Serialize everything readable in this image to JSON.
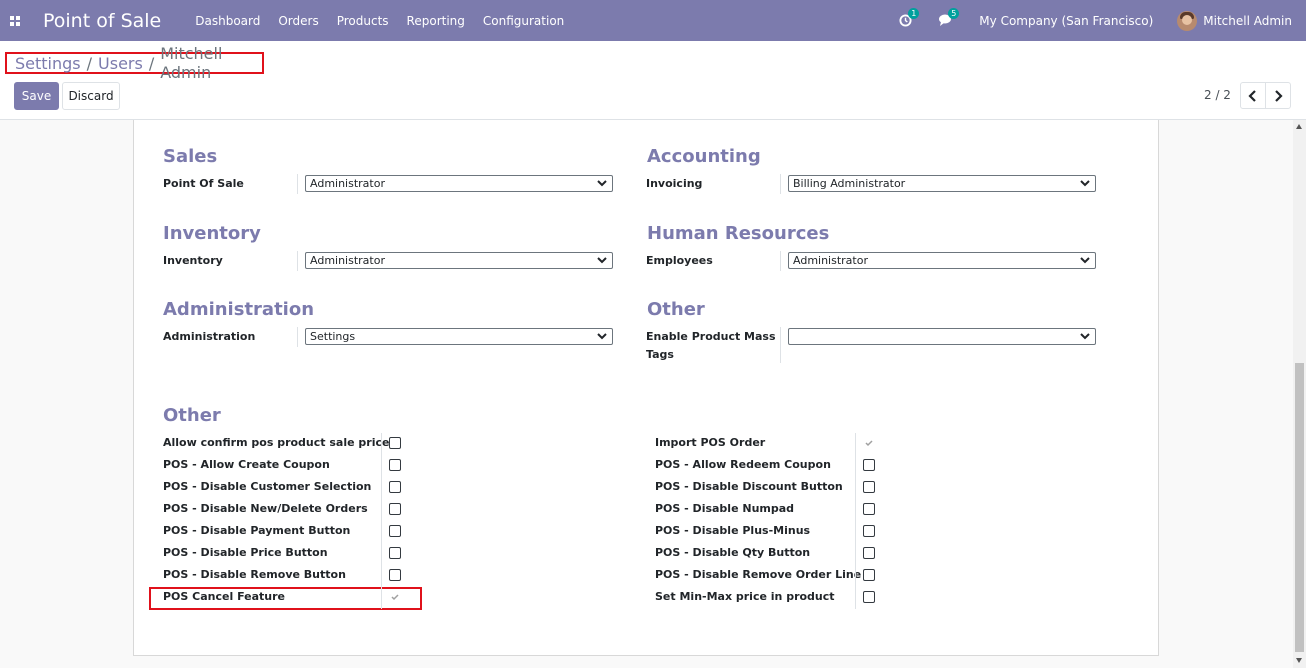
{
  "navbar": {
    "app_title": "Point of Sale",
    "menu": [
      "Dashboard",
      "Orders",
      "Products",
      "Reporting",
      "Configuration"
    ],
    "activity_badge": "1",
    "messages_badge": "5",
    "company": "My Company (San Francisco)",
    "user": "Mitchell Admin"
  },
  "breadcrumb": {
    "settings": "Settings",
    "users": "Users",
    "current": "Mitchell Admin"
  },
  "buttons": {
    "save": "Save",
    "discard": "Discard"
  },
  "pager": {
    "value": "2 / 2"
  },
  "groups": {
    "sales": {
      "title": "Sales",
      "label": "Point Of Sale",
      "value": "Administrator"
    },
    "accounting": {
      "title": "Accounting",
      "label": "Invoicing",
      "value": "Billing Administrator"
    },
    "inventory": {
      "title": "Inventory",
      "label": "Inventory",
      "value": "Administrator"
    },
    "hr": {
      "title": "Human Resources",
      "label": "Employees",
      "value": "Administrator"
    },
    "administration": {
      "title": "Administration",
      "label": "Administration",
      "value": "Settings"
    },
    "other_top": {
      "title": "Other",
      "label_1": "Enable Product Mass",
      "label_2": "Tags",
      "value": ""
    }
  },
  "other_section": {
    "title": "Other",
    "left": [
      {
        "label": "Allow confirm pos product sale price",
        "checked": false
      },
      {
        "label": "POS - Allow Create Coupon",
        "checked": false
      },
      {
        "label": "POS - Disable Customer Selection",
        "checked": false
      },
      {
        "label": "POS - Disable New/Delete Orders",
        "checked": false
      },
      {
        "label": "POS - Disable Payment Button",
        "checked": false
      },
      {
        "label": "POS - Disable Price Button",
        "checked": false
      },
      {
        "label": "POS - Disable Remove Button",
        "checked": false
      },
      {
        "label": "POS Cancel Feature",
        "checked": true
      }
    ],
    "right": [
      {
        "label": "Import POS Order",
        "checked": true
      },
      {
        "label": "POS - Allow Redeem Coupon",
        "checked": false
      },
      {
        "label": "POS - Disable Discount Button",
        "checked": false
      },
      {
        "label": "POS - Disable Numpad",
        "checked": false
      },
      {
        "label": "POS - Disable Plus-Minus",
        "checked": false
      },
      {
        "label": "POS - Disable Qty Button",
        "checked": false
      },
      {
        "label": "POS - Disable Remove Order Line",
        "checked": false
      },
      {
        "label": "Set Min-Max price in product",
        "checked": false
      }
    ]
  },
  "colors": {
    "brand": "#7c7bad",
    "highlight": "#e0111b",
    "badge": "#00a09d"
  }
}
